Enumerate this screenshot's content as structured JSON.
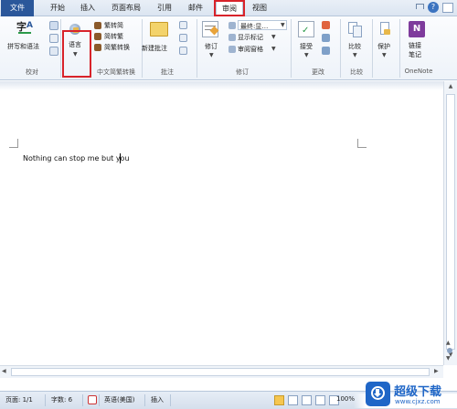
{
  "tabs": {
    "file": "文件",
    "home": "开始",
    "insert": "插入",
    "page_layout": "页面布局",
    "references": "引用",
    "mailings": "邮件",
    "review": "审阅",
    "view": "视图"
  },
  "ribbon": {
    "proofing": {
      "spelling": "拼写和语法",
      "group": "校对"
    },
    "language": {
      "label": "语言"
    },
    "chinese_conversion": {
      "to_simplified": "繁转简",
      "to_traditional": "简转繁",
      "convert": "简繁转换",
      "group": "中文简繁转换"
    },
    "comments": {
      "new_comment": "新建批注",
      "group": "批注"
    },
    "tracking": {
      "track_changes": "修订",
      "final_show": "最终:显…",
      "show_markup": "显示标记",
      "review_pane": "审阅窗格",
      "group": "修订"
    },
    "changes": {
      "accept": "接受",
      "group": "更改"
    },
    "compare": {
      "compare": "比较",
      "group": "比较"
    },
    "protect": {
      "protect": "保护"
    },
    "onenote": {
      "linked_notes_1": "链接",
      "linked_notes_2": "笔记",
      "group": "OneNote"
    }
  },
  "document": {
    "text": "Nothing can stop me but you"
  },
  "status": {
    "page": "页面: 1/1",
    "words": "字数: 6",
    "language": "英语(美国)",
    "mode": "插入",
    "zoom": "100%"
  },
  "watermark": {
    "brand": "超级下载",
    "url": "www.cjxz.com"
  },
  "colors": {
    "file_tab": "#2b579a",
    "highlight": "#d8232a"
  }
}
